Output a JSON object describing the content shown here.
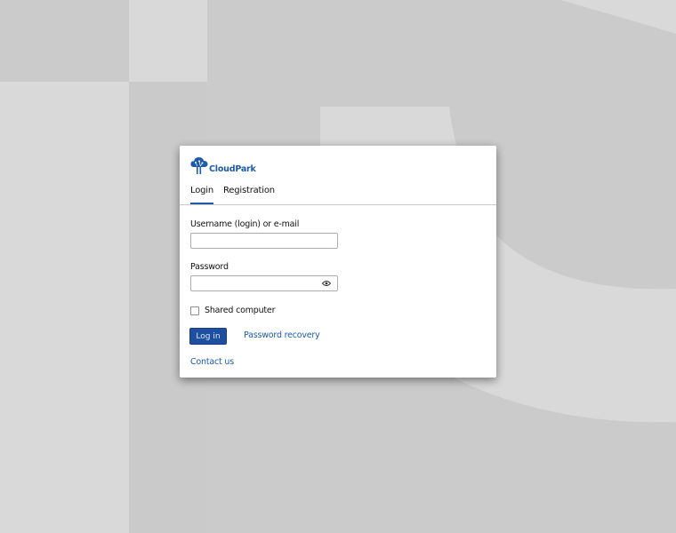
{
  "brand": {
    "name": "CloudPark",
    "color": "#1e5ba8"
  },
  "tabs": [
    {
      "label": "Login",
      "active": true
    },
    {
      "label": "Registration",
      "active": false
    }
  ],
  "form": {
    "username": {
      "label": "Username (login) or e-mail",
      "value": "",
      "placeholder": ""
    },
    "password": {
      "label": "Password",
      "value": "",
      "placeholder": "",
      "icon": "eye-icon"
    },
    "shared_computer": {
      "label": "Shared computer",
      "checked": false
    }
  },
  "actions": {
    "login_label": "Log in",
    "password_recovery": "Password recovery",
    "contact_us": "Contact us"
  },
  "colors": {
    "accent": "#1e5ba8",
    "button": "#1e4fa0",
    "background": "#cccccc"
  }
}
